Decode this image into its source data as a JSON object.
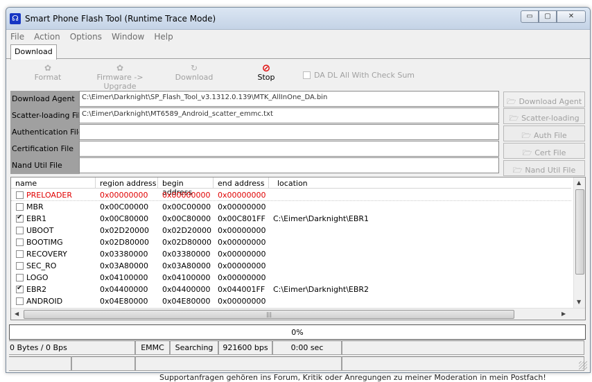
{
  "window": {
    "title": "Smart Phone Flash Tool (Runtime Trace Mode)"
  },
  "menu": [
    "File",
    "Action",
    "Options",
    "Window",
    "Help"
  ],
  "tab": "Download",
  "toolbar": {
    "format": "Format",
    "firmware_upgrade": "Firmware -> Upgrade",
    "download": "Download",
    "stop": "Stop",
    "da_checksum": "DA DL All With Check Sum"
  },
  "files": [
    {
      "label": "Download Agent",
      "value": "C:\\Eimer\\Darknight\\SP_Flash_Tool_v3.1312.0.139\\MTK_AllInOne_DA.bin",
      "button": "Download Agent"
    },
    {
      "label": "Scatter-loading File",
      "value": "C:\\Eimer\\Darknight\\MT6589_Android_scatter_emmc.txt",
      "button": "Scatter-loading"
    },
    {
      "label": "Authentication File",
      "value": "",
      "button": "Auth File"
    },
    {
      "label": "Certification File",
      "value": "",
      "button": "Cert File"
    },
    {
      "label": "Nand Util File",
      "value": "",
      "button": "Nand Util File"
    }
  ],
  "table": {
    "columns": [
      "name",
      "region address",
      "begin address",
      "end address",
      "location"
    ],
    "rows": [
      {
        "checked": false,
        "name": "PRELOADER",
        "region": "0x00000000",
        "begin": "0x00000000",
        "end": "0x00000000",
        "location": "",
        "red": true
      },
      {
        "checked": false,
        "name": "MBR",
        "region": "0x00C00000",
        "begin": "0x00C00000",
        "end": "0x00000000",
        "location": ""
      },
      {
        "checked": true,
        "name": "EBR1",
        "region": "0x00C80000",
        "begin": "0x00C80000",
        "end": "0x00C801FF",
        "location": "C:\\Eimer\\Darknight\\EBR1"
      },
      {
        "checked": false,
        "name": "UBOOT",
        "region": "0x02D20000",
        "begin": "0x02D20000",
        "end": "0x00000000",
        "location": ""
      },
      {
        "checked": false,
        "name": "BOOTIMG",
        "region": "0x02D80000",
        "begin": "0x02D80000",
        "end": "0x00000000",
        "location": ""
      },
      {
        "checked": false,
        "name": "RECOVERY",
        "region": "0x03380000",
        "begin": "0x03380000",
        "end": "0x00000000",
        "location": ""
      },
      {
        "checked": false,
        "name": "SEC_RO",
        "region": "0x03A80000",
        "begin": "0x03A80000",
        "end": "0x00000000",
        "location": ""
      },
      {
        "checked": false,
        "name": "LOGO",
        "region": "0x04100000",
        "begin": "0x04100000",
        "end": "0x00000000",
        "location": ""
      },
      {
        "checked": true,
        "name": "EBR2",
        "region": "0x04400000",
        "begin": "0x04400000",
        "end": "0x044001FF",
        "location": "C:\\Eimer\\Darknight\\EBR2"
      },
      {
        "checked": false,
        "name": "ANDROID",
        "region": "0x04E80000",
        "begin": "0x04E80000",
        "end": "0x00000000",
        "location": ""
      }
    ]
  },
  "progress": {
    "text": "0%",
    "value": 0
  },
  "status": {
    "bytes": "0 Bytes / 0 Bps",
    "storage": "EMMC",
    "state": "Searching",
    "baud": "921600 bps",
    "time": "0:00 sec"
  },
  "background_text": "Supportanfragen gehören ins Forum, Kritik oder Anregungen zu meiner Moderation in mein Postfach!",
  "colors": {
    "required_label": "#e00000",
    "stop_icon": "#e01010",
    "label_bg": "#a0a0a0"
  },
  "icons": {
    "app": "app-icon",
    "stop": "stop-icon",
    "browse": "folder-icon"
  }
}
